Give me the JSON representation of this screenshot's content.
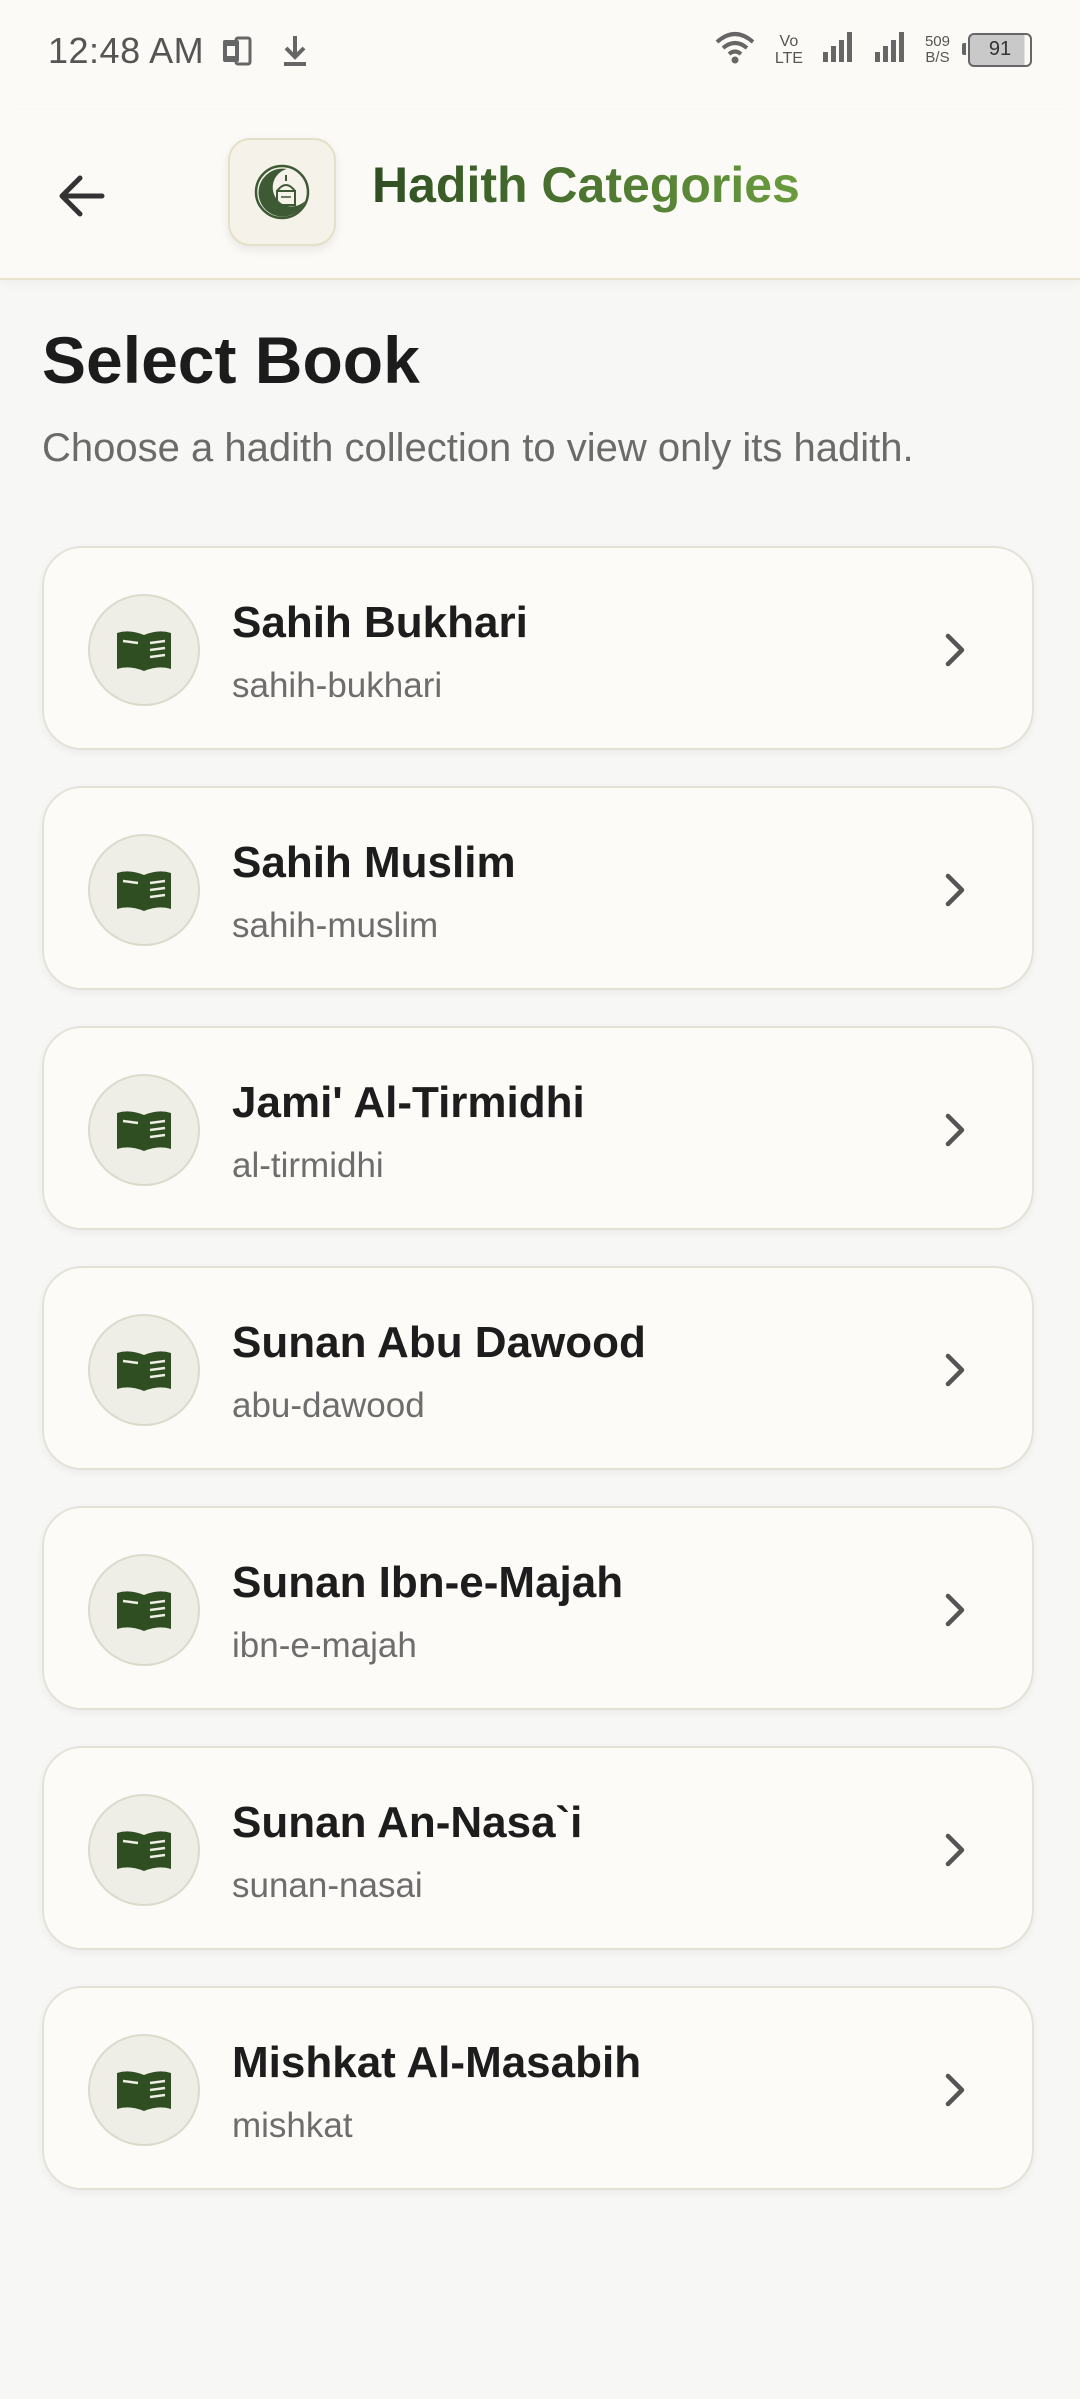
{
  "status_bar": {
    "time": "12:48 AM",
    "volte_top": "Vo",
    "volte_bottom": "LTE",
    "net_speed_value": "509",
    "net_speed_unit": "B/S",
    "battery_level": "91"
  },
  "header": {
    "title": "Hadith Categories"
  },
  "page": {
    "title": "Select Book",
    "subtitle": "Choose a hadith collection to view only its hadith."
  },
  "books": [
    {
      "name": "Sahih Bukhari",
      "slug": "sahih-bukhari"
    },
    {
      "name": "Sahih Muslim",
      "slug": "sahih-muslim"
    },
    {
      "name": "Jami' Al-Tirmidhi",
      "slug": "al-tirmidhi"
    },
    {
      "name": "Sunan Abu Dawood",
      "slug": "abu-dawood"
    },
    {
      "name": "Sunan Ibn-e-Majah",
      "slug": "ibn-e-majah"
    },
    {
      "name": "Sunan An-Nasa`i",
      "slug": "sunan-nasai"
    },
    {
      "name": "Mishkat Al-Masabih",
      "slug": "mishkat"
    }
  ],
  "colors": {
    "accent_dark": "#2f4f23",
    "accent_light": "#6a9c3e",
    "card_bg": "#fdfbf7",
    "page_bg": "#f7f7f5"
  },
  "icons": {
    "back": "arrow-left-icon",
    "logo": "crescent-mosque-icon",
    "book": "open-book-icon",
    "chevron": "chevron-right-icon"
  }
}
